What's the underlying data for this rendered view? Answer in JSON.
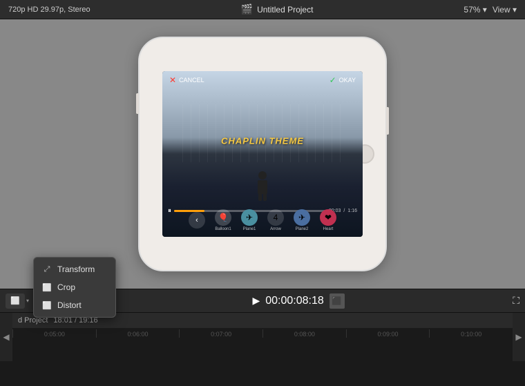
{
  "topBar": {
    "resolution": "720p HD 29.97p, Stereo",
    "filmIconSymbol": "🎬",
    "projectTitle": "Untitled Project",
    "zoom": "57%",
    "viewLabel": "View",
    "dropdownArrow": "▾"
  },
  "phoneScreen": {
    "cancelLabel": "CANCEL",
    "okayLabel": "OKAY",
    "chaplinText": "CHAPLIN THEME",
    "timeLabel": "00:03",
    "durationLabel": "1:16",
    "stickers": [
      {
        "label": "Balloon1",
        "emoji": "🎈"
      },
      {
        "label": "Plane1",
        "emoji": "✈"
      },
      {
        "label": "Arrow",
        "emoji": "4"
      },
      {
        "label": "Plane2",
        "emoji": "🔵"
      },
      {
        "label": "Heart",
        "emoji": "❤"
      }
    ]
  },
  "bottomToolbar": {
    "timecode": "00:00:0",
    "frames": "8:18",
    "playSymbol": "▶",
    "insertSymbol": "⬛",
    "fullscreenSymbol": "⛶"
  },
  "timeline": {
    "navLeft": "◀",
    "navRight": "▶",
    "projectLabel": "d Project",
    "timecodeInfo": "18:01 / 19:16",
    "rulerMarks": [
      "0:05:00",
      "0:06:00",
      "0:07:00",
      "0:08:00",
      "0:09:00",
      "0:10:00"
    ]
  },
  "dropdownMenu": {
    "items": [
      {
        "label": "Transform",
        "iconSymbol": "⤢"
      },
      {
        "label": "Crop",
        "iconSymbol": "⬜"
      },
      {
        "label": "Distort",
        "iconSymbol": "⬜"
      }
    ]
  }
}
